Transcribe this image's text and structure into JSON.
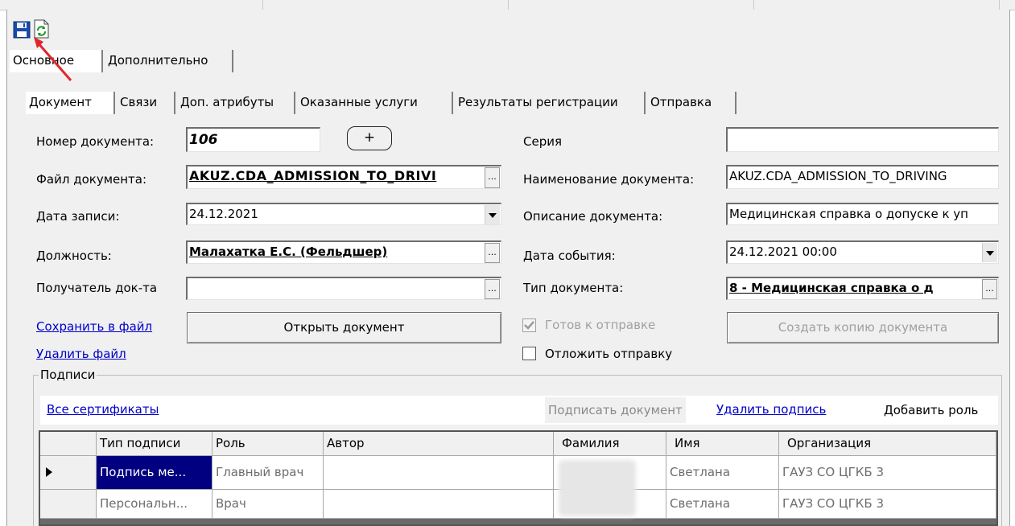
{
  "toolbar": {
    "save": "floppy-disk",
    "refresh": "refresh-doc"
  },
  "outer_tabs": [
    {
      "label": "Основное"
    },
    {
      "label": "Дополнительно"
    }
  ],
  "inner_tabs": [
    {
      "label": "Документ"
    },
    {
      "label": "Связи"
    },
    {
      "label": "Доп. атрибуты"
    },
    {
      "label": "Оказанные услуги"
    },
    {
      "label": "Результаты регистрации"
    },
    {
      "label": "Отправка"
    }
  ],
  "left_form": {
    "doc_number_label": "Номер документа:",
    "doc_number_value": "106",
    "plus_label": "+",
    "doc_file_label": "Файл документа:",
    "doc_file_value": "AKUZ.CDA_ADMISSION_TO_DRIVI",
    "record_date_label": "Дата записи:",
    "record_date_value": "24.12.2021",
    "position_label": "Должность:",
    "position_value": "Малахатка Е.С. (Фельдшер)",
    "recipient_label": "Получатель док-та",
    "recipient_value": "",
    "save_to_file": "Сохранить в файл",
    "delete_file": "Удалить файл",
    "open_doc": "Открыть документ"
  },
  "right_form": {
    "series_label": "Серия",
    "series_value": "",
    "doc_name_label": "Наименование документа:",
    "doc_name_value": "AKUZ.CDA_ADMISSION_TO_DRIVING",
    "doc_desc_label": "Описание документа:",
    "doc_desc_value": "Медицинская справка о допуске к уп",
    "event_date_label": "Дата события:",
    "event_date_value": "24.12.2021 00:00",
    "doc_type_label": "Тип документа:",
    "doc_type_value": "8 - Медицинская справка о д",
    "ready_label": "Готов к отправке",
    "ready_checked": true,
    "postpone_label": "Отложить отправку",
    "postpone_checked": false,
    "copy_doc": "Создать копию документа"
  },
  "signatures": {
    "group_label": "Подписи",
    "all_certs": "Все сертификаты",
    "sign_doc": "Подписать документ",
    "delete_sig": "Удалить подпись",
    "add_role": "Добавить роль",
    "columns": [
      "Тип подписи",
      "Роль",
      "Автор",
      "Фамилия",
      "Имя",
      "Организация"
    ],
    "rows": [
      {
        "type": "Подпись ме...",
        "role": "Главный врач",
        "author": "",
        "last": "",
        "first": "Светлана",
        "org": "ГАУЗ СО ЦГКБ 3"
      },
      {
        "type": "Персональн...",
        "role": "Врач",
        "author": "",
        "last": "",
        "first": "Светлана",
        "org": "ГАУЗ СО ЦГКБ 3"
      }
    ]
  },
  "colors": {
    "link": "#0000c8",
    "selected_cell": "#000080",
    "arrow": "#e0262b"
  }
}
